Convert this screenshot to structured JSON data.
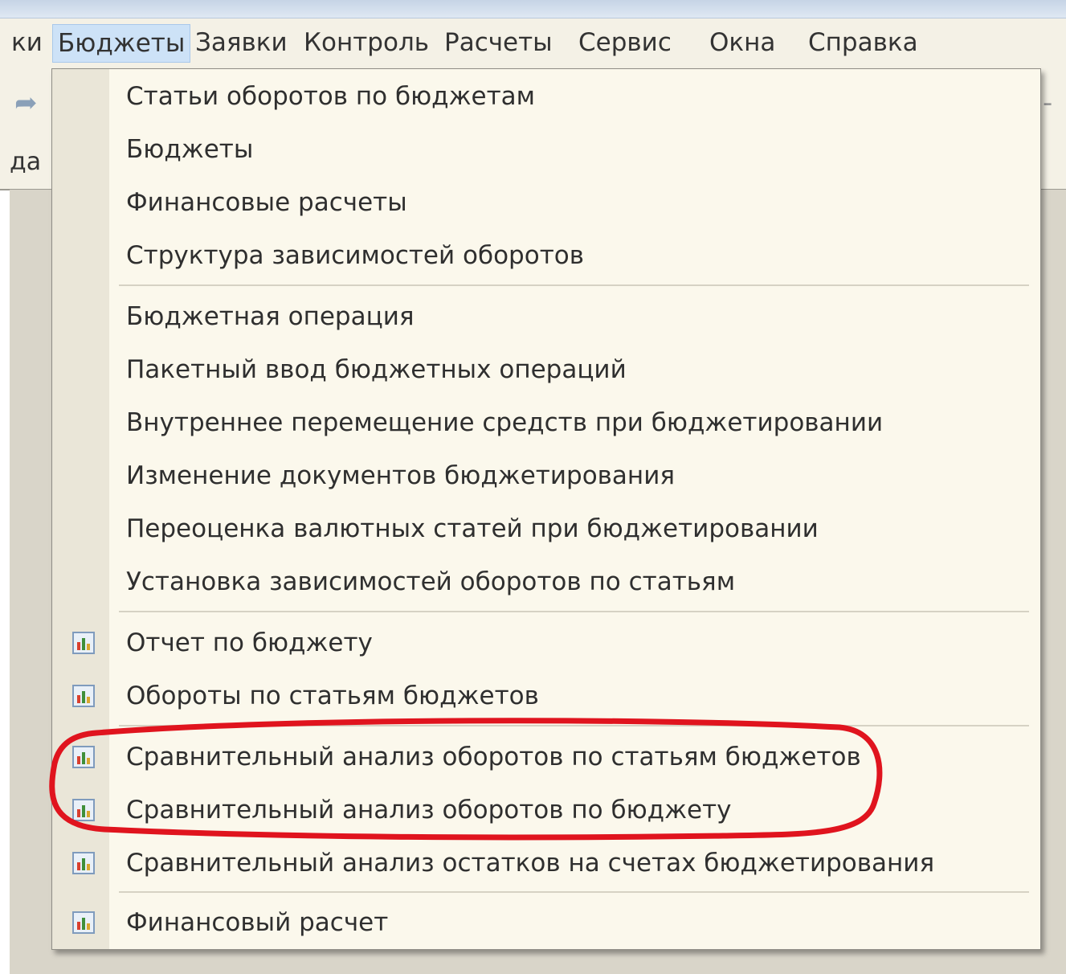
{
  "menubar": {
    "items": [
      {
        "label": "ки"
      },
      {
        "label": "Бюджеты",
        "active": true
      },
      {
        "label": "Заявки"
      },
      {
        "label": "Контроль"
      },
      {
        "label": "Расчеты"
      },
      {
        "label": "Сервис"
      },
      {
        "label": "Окна"
      },
      {
        "label": "Справка"
      }
    ]
  },
  "toolbar": {
    "cut_text": "да",
    "back_icon": "back-arrow-icon",
    "right_edge_glyph": "-"
  },
  "dropdown": {
    "items": [
      {
        "label": "Статьи оборотов по бюджетам"
      },
      {
        "label": "Бюджеты"
      },
      {
        "label": "Финансовые расчеты"
      },
      {
        "label": "Структура зависимостей оборотов"
      },
      {
        "label": "Бюджетная операция"
      },
      {
        "label": "Пакетный ввод бюджетных операций"
      },
      {
        "label": "Внутреннее перемещение средств при бюджетировании"
      },
      {
        "label": "Изменение документов бюджетирования"
      },
      {
        "label": "Переоценка валютных статей при бюджетировании"
      },
      {
        "label": "Установка зависимостей оборотов по статьям"
      },
      {
        "label": "Отчет по бюджету",
        "icon": "report-chart-icon"
      },
      {
        "label": "Обороты по статьям бюджетов",
        "icon": "report-chart-icon"
      },
      {
        "label": "Сравнительный анализ оборотов по статьям бюджетов",
        "icon": "report-chart-icon",
        "highlighted": true
      },
      {
        "label": "Сравнительный анализ оборотов по бюджету",
        "icon": "report-chart-icon",
        "highlighted": true
      },
      {
        "label": "Сравнительный анализ остатков на счетах бюджетирования",
        "icon": "report-chart-icon"
      },
      {
        "label": "Финансовый расчет",
        "icon": "report-chart-icon"
      }
    ]
  },
  "colors": {
    "menu_bg": "#fbf8ec",
    "gutter": "#eae6d8",
    "active_menu": "#cde2f7",
    "annotation": "#e0141e"
  }
}
